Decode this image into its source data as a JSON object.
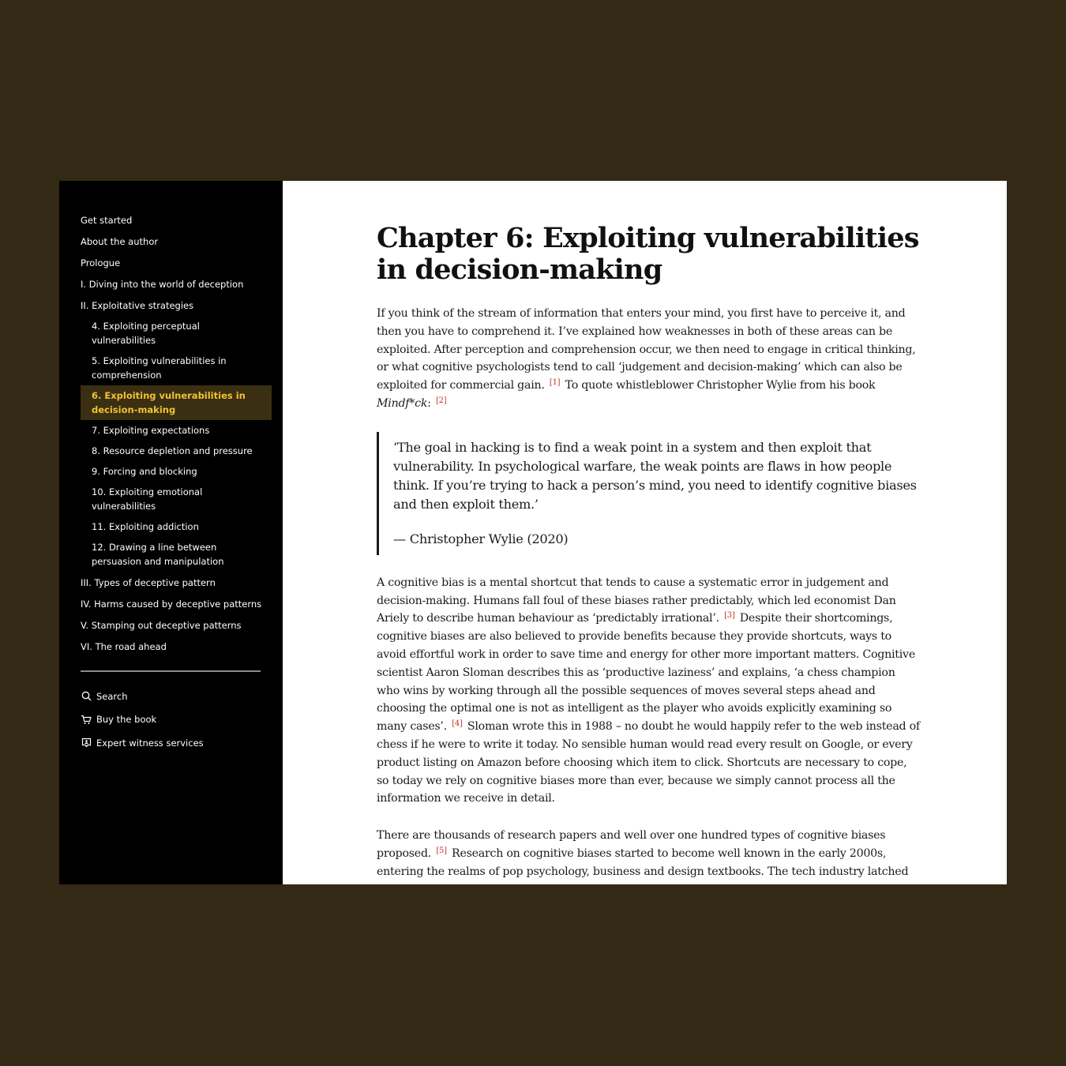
{
  "colors": {
    "page_background": "#332914",
    "sidebar_background": "#000000",
    "active_item_background": "#3a2f12",
    "active_item_text": "#f1c232",
    "footnote": "#c0392b"
  },
  "sidebar": {
    "toc": [
      {
        "label": "Get started",
        "level": 0
      },
      {
        "label": "About the author",
        "level": 0
      },
      {
        "label": "Prologue",
        "level": 0
      },
      {
        "label": "I. Diving into the world of deception",
        "level": 0
      },
      {
        "label": "II. Exploitative strategies",
        "level": 0
      },
      {
        "label": "4. Exploiting perceptual vulnerabilities",
        "level": 1
      },
      {
        "label": "5. Exploiting vulnerabilities in comprehension",
        "level": 1
      },
      {
        "label": "6. Exploiting vulnerabilities in decision-making",
        "level": 1,
        "active": true
      },
      {
        "label": "7. Exploiting expectations",
        "level": 1
      },
      {
        "label": "8. Resource depletion and pressure",
        "level": 1
      },
      {
        "label": "9. Forcing and blocking",
        "level": 1
      },
      {
        "label": "10. Exploiting emotional vulnerabilities",
        "level": 1
      },
      {
        "label": "11. Exploiting addiction",
        "level": 1
      },
      {
        "label": "12. Drawing a line between persuasion and manipulation",
        "level": 1
      },
      {
        "label": "III. Types of deceptive pattern",
        "level": 0
      },
      {
        "label": "IV. Harms caused by deceptive patterns",
        "level": 0
      },
      {
        "label": "V. Stamping out deceptive patterns",
        "level": 0
      },
      {
        "label": "VI. The road ahead",
        "level": 0
      }
    ],
    "tools": [
      {
        "label": "Search",
        "icon": "search-icon"
      },
      {
        "label": "Buy the book",
        "icon": "cart-icon"
      },
      {
        "label": "Expert witness services",
        "icon": "person-badge-icon"
      }
    ]
  },
  "article": {
    "title": "Chapter 6: Exploiting vulnerabilities in decision-making",
    "p1": {
      "a": "If you think of the stream of information that enters your mind, you first have to perceive it, and then you have to comprehend it. I’ve explained how weaknesses in both of these areas can be exploited. After perception and comprehension occur, we then need to engage in critical thinking, or what cognitive psychologists tend to call ‘judgement and decision-making’ which can also be exploited for commercial gain.",
      "fn1": "[1]",
      "b": " To quote whistleblower Christopher Wylie from his book ",
      "book": "Mindf*ck",
      "c": ":",
      "fn2": "[2]"
    },
    "quote": {
      "text": "‘The goal in hacking is to find a weak point in a system and then exploit that vulnerability. In psychological warfare, the weak points are flaws in how people think. If you’re trying to hack a person’s mind, you need to identify cognitive biases and then exploit them.’",
      "citation": "— Christopher Wylie (2020)"
    },
    "p2": {
      "a": "A cognitive bias is a mental shortcut that tends to cause a systematic error in judgement and decision-making. Humans fall foul of these biases rather predictably, which led economist Dan Ariely to describe human behaviour as ‘predictably irrational’.",
      "fn3": "[3]",
      "b": " Despite their shortcomings, cognitive biases are also believed to provide benefits because they provide shortcuts, ways to avoid effortful work in order to save time and energy for other more important matters. Cognitive scientist Aaron Sloman describes this as ‘productive laziness’ and explains, ‘a chess champion who wins by working through all the possible sequences of moves several steps ahead and choosing the optimal one is not as intelligent as the player who avoids explicitly examining so many cases’.",
      "fn4": "[4]",
      "c": " Sloman wrote this in 1988 – no doubt he would happily refer to the web instead of chess if he were to write it today. No sensible human would read every result on Google, or every product listing on Amazon before choosing which item to click. Shortcuts are necessary to cope, so today we rely on cognitive biases more than ever, because we simply cannot process all the information we receive in detail."
    },
    "p3": {
      "a": "There are thousands of research papers and well over one hundred types of cognitive biases proposed.",
      "fn5": "[5]",
      "b": " Research on cognitive biases started to become well known in the early 2000s, entering the realms of pop psychology, business and design textbooks. The tech industry latched onto this with a great deal of enthusiasm. Some authors were very direct about the purpose of"
    }
  }
}
